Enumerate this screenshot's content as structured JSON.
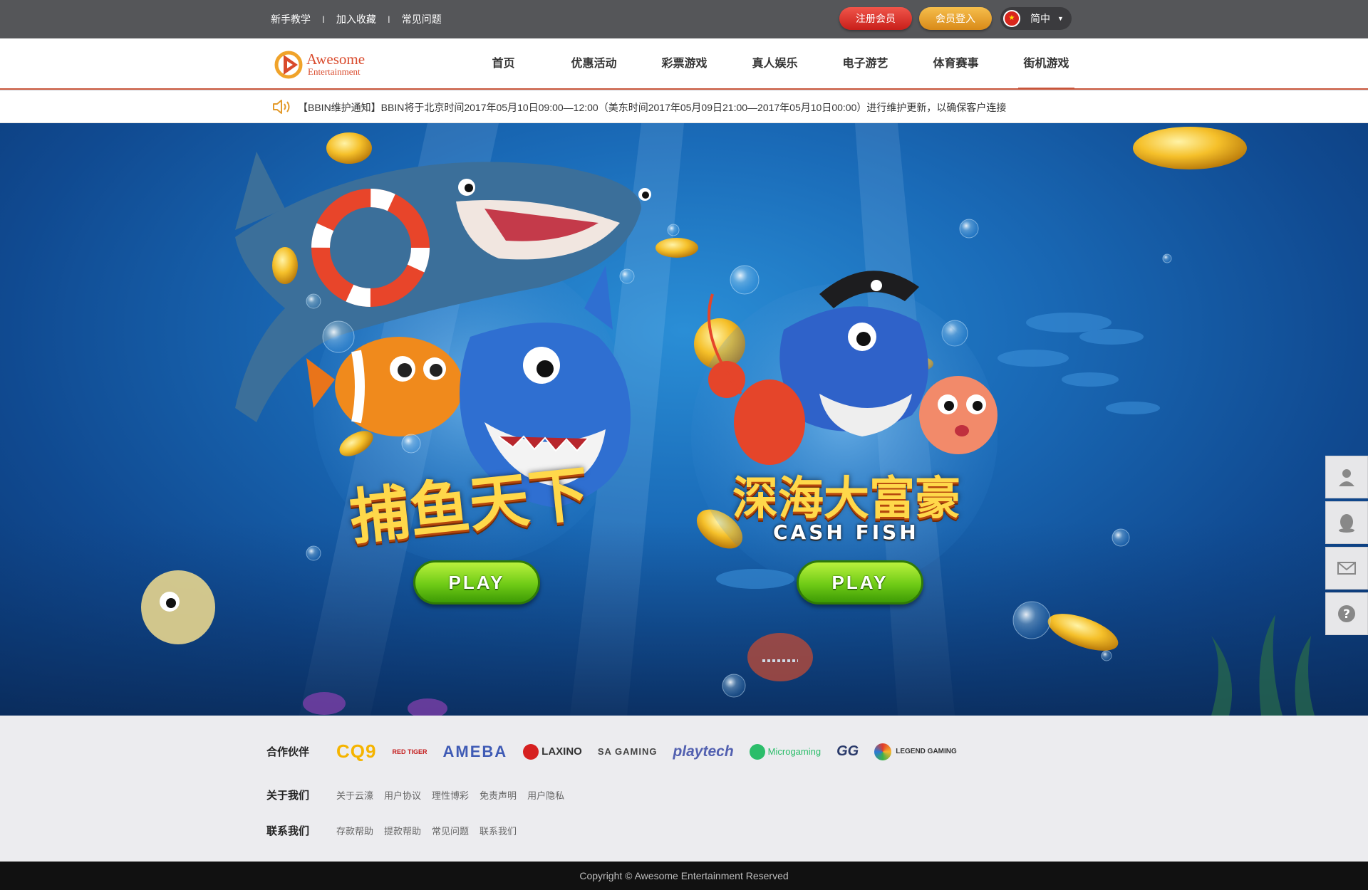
{
  "topbar": {
    "links": [
      "新手教学",
      "加入收藏",
      "常见问题"
    ],
    "register_label": "注册会员",
    "login_label": "会员登入",
    "language": "简中"
  },
  "brand": {
    "name_line1": "Awesome",
    "name_line2": "Entertainment",
    "color": "#d94a2c"
  },
  "nav": {
    "items": [
      "首页",
      "优惠活动",
      "彩票游戏",
      "真人娱乐",
      "电子游艺",
      "体育赛事",
      "街机游戏"
    ],
    "active_index": 6
  },
  "notice": {
    "text": "【BBIN维护通知】BBIN将于北京时间2017年05月10日09:00—12:00（美东时间2017年05月09日21:00—2017年05月10日00:00）进行维护更新，以确保客户连接"
  },
  "games": [
    {
      "title": "捕鱼天下",
      "subtitle": "",
      "play_label": "PLAY"
    },
    {
      "title": "深海大富豪",
      "subtitle": "CASH FISH",
      "play_label": "PLAY"
    }
  ],
  "side_tools": [
    "user-icon",
    "qq-icon",
    "mail-icon",
    "help-icon"
  ],
  "footer": {
    "partners_label": "合作伙伴",
    "partners": [
      "CQ9",
      "RED TIGER",
      "AMEBA",
      "LAXINO",
      "SA GAMING",
      "playtech",
      "Microgaming",
      "GG",
      "LEGEND GAMING"
    ],
    "about_label": "关于我们",
    "about_links": [
      "关于云濠",
      "用户协议",
      "理性博彩",
      "免责声明",
      "用户隐私"
    ],
    "contact_label": "联系我们",
    "contact_links": [
      "存款帮助",
      "提款帮助",
      "常见问题",
      "联系我们"
    ],
    "copyright": "Copyright © Awesome Entertainment Reserved"
  }
}
